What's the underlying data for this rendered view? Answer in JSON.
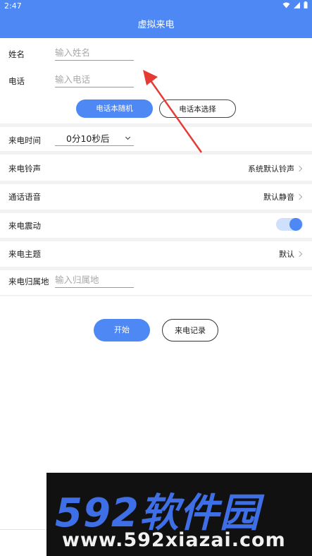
{
  "status_bar": {
    "time": "2:47",
    "wifi_icon": "wifi-icon",
    "signal_icon": "signal-icon",
    "battery_icon": "battery-icon"
  },
  "app_bar": {
    "title": "虚拟来电"
  },
  "form": {
    "name_label": "姓名",
    "name_placeholder": "输入姓名",
    "phone_label": "电话",
    "phone_placeholder": "输入电话",
    "random_button": "电话本随机",
    "select_button": "电话本选择"
  },
  "settings": {
    "call_time_label": "来电时间",
    "call_time_value": "0分10秒后",
    "ringtone_label": "来电铃声",
    "ringtone_value": "系统默认铃声",
    "voice_label": "通话语音",
    "voice_value": "默认静音",
    "vibrate_label": "来电震动",
    "vibrate_on": true,
    "theme_label": "来电主题",
    "theme_value": "默认",
    "location_label": "来电归属地",
    "location_placeholder": "输入归属地"
  },
  "actions": {
    "start": "开始",
    "history": "来电记录"
  },
  "watermark": {
    "logo": "592软件园",
    "url": "www.592xiazai.com"
  },
  "colors": {
    "primary": "#4d88f4",
    "annotation_arrow": "#e43b35"
  }
}
